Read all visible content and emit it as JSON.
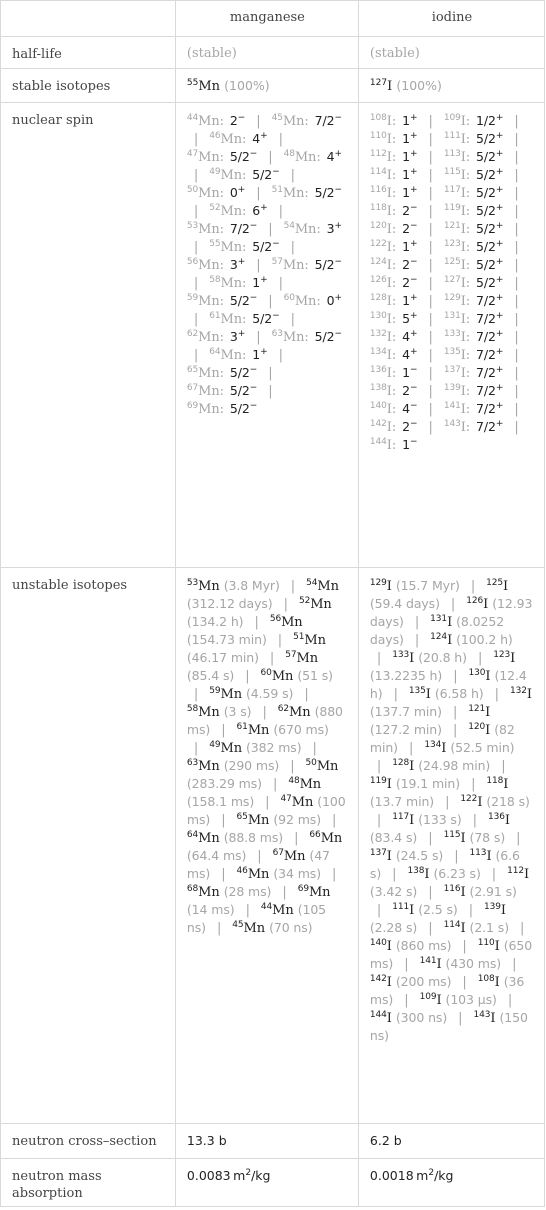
{
  "table": {
    "columns": [
      "",
      "manganese",
      "iodine"
    ],
    "rows": {
      "half_life": {
        "label": "half-life",
        "manganese": "(stable)",
        "iodine": "(stable)"
      },
      "stable_isotopes": {
        "label": "stable isotopes",
        "manganese": {
          "mass": "55",
          "symbol": "Mn",
          "abundance": "(100%)"
        },
        "iodine": {
          "mass": "127",
          "symbol": "I",
          "abundance": "(100%)"
        }
      },
      "nuclear_spin": {
        "label": "nuclear spin",
        "manganese": [
          {
            "mass": "44",
            "symbol": "Mn:",
            "spin": "2",
            "parity": "−"
          },
          {
            "mass": "45",
            "symbol": "Mn:",
            "spin": "7/2",
            "parity": "−"
          },
          {
            "mass": "46",
            "symbol": "Mn:",
            "spin": "4",
            "parity": "+"
          },
          {
            "mass": "47",
            "symbol": "Mn:",
            "spin": "5/2",
            "parity": "−"
          },
          {
            "mass": "48",
            "symbol": "Mn:",
            "spin": "4",
            "parity": "+"
          },
          {
            "mass": "49",
            "symbol": "Mn:",
            "spin": "5/2",
            "parity": "−"
          },
          {
            "mass": "50",
            "symbol": "Mn:",
            "spin": "0",
            "parity": "+"
          },
          {
            "mass": "51",
            "symbol": "Mn:",
            "spin": "5/2",
            "parity": "−"
          },
          {
            "mass": "52",
            "symbol": "Mn:",
            "spin": "6",
            "parity": "+"
          },
          {
            "mass": "53",
            "symbol": "Mn:",
            "spin": "7/2",
            "parity": "−"
          },
          {
            "mass": "54",
            "symbol": "Mn:",
            "spin": "3",
            "parity": "+"
          },
          {
            "mass": "55",
            "symbol": "Mn:",
            "spin": "5/2",
            "parity": "−"
          },
          {
            "mass": "56",
            "symbol": "Mn:",
            "spin": "3",
            "parity": "+"
          },
          {
            "mass": "57",
            "symbol": "Mn:",
            "spin": "5/2",
            "parity": "−"
          },
          {
            "mass": "58",
            "symbol": "Mn:",
            "spin": "1",
            "parity": "+"
          },
          {
            "mass": "59",
            "symbol": "Mn:",
            "spin": "5/2",
            "parity": "−"
          },
          {
            "mass": "60",
            "symbol": "Mn:",
            "spin": "0",
            "parity": "+"
          },
          {
            "mass": "61",
            "symbol": "Mn:",
            "spin": "5/2",
            "parity": "−"
          },
          {
            "mass": "62",
            "symbol": "Mn:",
            "spin": "3",
            "parity": "+"
          },
          {
            "mass": "63",
            "symbol": "Mn:",
            "spin": "5/2",
            "parity": "−"
          },
          {
            "mass": "64",
            "symbol": "Mn:",
            "spin": "1",
            "parity": "+"
          },
          {
            "mass": "65",
            "symbol": "Mn:",
            "spin": "5/2",
            "parity": "−"
          },
          {
            "mass": "67",
            "symbol": "Mn:",
            "spin": "5/2",
            "parity": "−"
          },
          {
            "mass": "69",
            "symbol": "Mn:",
            "spin": "5/2",
            "parity": "−"
          }
        ],
        "iodine": [
          {
            "mass": "108",
            "symbol": "I:",
            "spin": "1",
            "parity": "+"
          },
          {
            "mass": "109",
            "symbol": "I:",
            "spin": "1/2",
            "parity": "+"
          },
          {
            "mass": "110",
            "symbol": "I:",
            "spin": "1",
            "parity": "+"
          },
          {
            "mass": "111",
            "symbol": "I:",
            "spin": "5/2",
            "parity": "+"
          },
          {
            "mass": "112",
            "symbol": "I:",
            "spin": "1",
            "parity": "+"
          },
          {
            "mass": "113",
            "symbol": "I:",
            "spin": "5/2",
            "parity": "+"
          },
          {
            "mass": "114",
            "symbol": "I:",
            "spin": "1",
            "parity": "+"
          },
          {
            "mass": "115",
            "symbol": "I:",
            "spin": "5/2",
            "parity": "+"
          },
          {
            "mass": "116",
            "symbol": "I:",
            "spin": "1",
            "parity": "+"
          },
          {
            "mass": "117",
            "symbol": "I:",
            "spin": "5/2",
            "parity": "+"
          },
          {
            "mass": "118",
            "symbol": "I:",
            "spin": "2",
            "parity": "−"
          },
          {
            "mass": "119",
            "symbol": "I:",
            "spin": "5/2",
            "parity": "+"
          },
          {
            "mass": "120",
            "symbol": "I:",
            "spin": "2",
            "parity": "−"
          },
          {
            "mass": "121",
            "symbol": "I:",
            "spin": "5/2",
            "parity": "+"
          },
          {
            "mass": "122",
            "symbol": "I:",
            "spin": "1",
            "parity": "+"
          },
          {
            "mass": "123",
            "symbol": "I:",
            "spin": "5/2",
            "parity": "+"
          },
          {
            "mass": "124",
            "symbol": "I:",
            "spin": "2",
            "parity": "−"
          },
          {
            "mass": "125",
            "symbol": "I:",
            "spin": "5/2",
            "parity": "+"
          },
          {
            "mass": "126",
            "symbol": "I:",
            "spin": "2",
            "parity": "−"
          },
          {
            "mass": "127",
            "symbol": "I:",
            "spin": "5/2",
            "parity": "+"
          },
          {
            "mass": "128",
            "symbol": "I:",
            "spin": "1",
            "parity": "+"
          },
          {
            "mass": "129",
            "symbol": "I:",
            "spin": "7/2",
            "parity": "+"
          },
          {
            "mass": "130",
            "symbol": "I:",
            "spin": "5",
            "parity": "+"
          },
          {
            "mass": "131",
            "symbol": "I:",
            "spin": "7/2",
            "parity": "+"
          },
          {
            "mass": "132",
            "symbol": "I:",
            "spin": "4",
            "parity": "+"
          },
          {
            "mass": "133",
            "symbol": "I:",
            "spin": "7/2",
            "parity": "+"
          },
          {
            "mass": "134",
            "symbol": "I:",
            "spin": "4",
            "parity": "+"
          },
          {
            "mass": "135",
            "symbol": "I:",
            "spin": "7/2",
            "parity": "+"
          },
          {
            "mass": "136",
            "symbol": "I:",
            "spin": "1",
            "parity": "−"
          },
          {
            "mass": "137",
            "symbol": "I:",
            "spin": "7/2",
            "parity": "+"
          },
          {
            "mass": "138",
            "symbol": "I:",
            "spin": "2",
            "parity": "−"
          },
          {
            "mass": "139",
            "symbol": "I:",
            "spin": "7/2",
            "parity": "+"
          },
          {
            "mass": "140",
            "symbol": "I:",
            "spin": "4",
            "parity": "−"
          },
          {
            "mass": "141",
            "symbol": "I:",
            "spin": "7/2",
            "parity": "+"
          },
          {
            "mass": "142",
            "symbol": "I:",
            "spin": "2",
            "parity": "−"
          },
          {
            "mass": "143",
            "symbol": "I:",
            "spin": "7/2",
            "parity": "+"
          },
          {
            "mass": "144",
            "symbol": "I:",
            "spin": "1",
            "parity": "−"
          }
        ]
      },
      "unstable_isotopes": {
        "label": "unstable isotopes",
        "manganese": [
          {
            "mass": "53",
            "symbol": "Mn",
            "half_life": "(3.8 Myr)"
          },
          {
            "mass": "54",
            "symbol": "Mn",
            "half_life": "(312.12 days)"
          },
          {
            "mass": "52",
            "symbol": "Mn",
            "half_life": "(134.2 h)"
          },
          {
            "mass": "56",
            "symbol": "Mn",
            "half_life": "(154.73 min)"
          },
          {
            "mass": "51",
            "symbol": "Mn",
            "half_life": "(46.17 min)"
          },
          {
            "mass": "57",
            "symbol": "Mn",
            "half_life": "(85.4 s)"
          },
          {
            "mass": "60",
            "symbol": "Mn",
            "half_life": "(51 s)"
          },
          {
            "mass": "59",
            "symbol": "Mn",
            "half_life": "(4.59 s)"
          },
          {
            "mass": "58",
            "symbol": "Mn",
            "half_life": "(3 s)"
          },
          {
            "mass": "62",
            "symbol": "Mn",
            "half_life": "(880 ms)"
          },
          {
            "mass": "61",
            "symbol": "Mn",
            "half_life": "(670 ms)"
          },
          {
            "mass": "49",
            "symbol": "Mn",
            "half_life": "(382 ms)"
          },
          {
            "mass": "63",
            "symbol": "Mn",
            "half_life": "(290 ms)"
          },
          {
            "mass": "50",
            "symbol": "Mn",
            "half_life": "(283.29 ms)"
          },
          {
            "mass": "48",
            "symbol": "Mn",
            "half_life": "(158.1 ms)"
          },
          {
            "mass": "47",
            "symbol": "Mn",
            "half_life": "(100 ms)"
          },
          {
            "mass": "65",
            "symbol": "Mn",
            "half_life": "(92 ms)"
          },
          {
            "mass": "64",
            "symbol": "Mn",
            "half_life": "(88.8 ms)"
          },
          {
            "mass": "66",
            "symbol": "Mn",
            "half_life": "(64.4 ms)"
          },
          {
            "mass": "67",
            "symbol": "Mn",
            "half_life": "(47 ms)"
          },
          {
            "mass": "46",
            "symbol": "Mn",
            "half_life": "(34 ms)"
          },
          {
            "mass": "68",
            "symbol": "Mn",
            "half_life": "(28 ms)"
          },
          {
            "mass": "69",
            "symbol": "Mn",
            "half_life": "(14 ms)"
          },
          {
            "mass": "44",
            "symbol": "Mn",
            "half_life": "(105 ns)"
          },
          {
            "mass": "45",
            "symbol": "Mn",
            "half_life": "(70 ns)"
          }
        ],
        "iodine": [
          {
            "mass": "129",
            "symbol": "I",
            "half_life": "(15.7 Myr)"
          },
          {
            "mass": "125",
            "symbol": "I",
            "half_life": "(59.4 days)"
          },
          {
            "mass": "126",
            "symbol": "I",
            "half_life": "(12.93 days)"
          },
          {
            "mass": "131",
            "symbol": "I",
            "half_life": "(8.0252 days)"
          },
          {
            "mass": "124",
            "symbol": "I",
            "half_life": "(100.2 h)"
          },
          {
            "mass": "133",
            "symbol": "I",
            "half_life": "(20.8 h)"
          },
          {
            "mass": "123",
            "symbol": "I",
            "half_life": "(13.2235 h)"
          },
          {
            "mass": "130",
            "symbol": "I",
            "half_life": "(12.4 h)"
          },
          {
            "mass": "135",
            "symbol": "I",
            "half_life": "(6.58 h)"
          },
          {
            "mass": "132",
            "symbol": "I",
            "half_life": "(137.7 min)"
          },
          {
            "mass": "121",
            "symbol": "I",
            "half_life": "(127.2 min)"
          },
          {
            "mass": "120",
            "symbol": "I",
            "half_life": "(82 min)"
          },
          {
            "mass": "134",
            "symbol": "I",
            "half_life": "(52.5 min)"
          },
          {
            "mass": "128",
            "symbol": "I",
            "half_life": "(24.98 min)"
          },
          {
            "mass": "119",
            "symbol": "I",
            "half_life": "(19.1 min)"
          },
          {
            "mass": "118",
            "symbol": "I",
            "half_life": "(13.7 min)"
          },
          {
            "mass": "122",
            "symbol": "I",
            "half_life": "(218 s)"
          },
          {
            "mass": "117",
            "symbol": "I",
            "half_life": "(133 s)"
          },
          {
            "mass": "136",
            "symbol": "I",
            "half_life": "(83.4 s)"
          },
          {
            "mass": "115",
            "symbol": "I",
            "half_life": "(78 s)"
          },
          {
            "mass": "137",
            "symbol": "I",
            "half_life": "(24.5 s)"
          },
          {
            "mass": "113",
            "symbol": "I",
            "half_life": "(6.6 s)"
          },
          {
            "mass": "138",
            "symbol": "I",
            "half_life": "(6.23 s)"
          },
          {
            "mass": "112",
            "symbol": "I",
            "half_life": "(3.42 s)"
          },
          {
            "mass": "116",
            "symbol": "I",
            "half_life": "(2.91 s)"
          },
          {
            "mass": "111",
            "symbol": "I",
            "half_life": "(2.5 s)"
          },
          {
            "mass": "139",
            "symbol": "I",
            "half_life": "(2.28 s)"
          },
          {
            "mass": "114",
            "symbol": "I",
            "half_life": "(2.1 s)"
          },
          {
            "mass": "140",
            "symbol": "I",
            "half_life": "(860 ms)"
          },
          {
            "mass": "110",
            "symbol": "I",
            "half_life": "(650 ms)"
          },
          {
            "mass": "141",
            "symbol": "I",
            "half_life": "(430 ms)"
          },
          {
            "mass": "142",
            "symbol": "I",
            "half_life": "(200 ms)"
          },
          {
            "mass": "108",
            "symbol": "I",
            "half_life": "(36 ms)"
          },
          {
            "mass": "109",
            "symbol": "I",
            "half_life": "(103 μs)"
          },
          {
            "mass": "144",
            "symbol": "I",
            "half_life": "(300 ns)"
          },
          {
            "mass": "143",
            "symbol": "I",
            "half_life": "(150 ns)"
          }
        ]
      },
      "neutron_cross_section": {
        "label": "neutron cross–section",
        "manganese": "13.3 b",
        "iodine": "6.2 b"
      },
      "neutron_mass_absorption": {
        "label": "neutron mass absorption",
        "manganese": {
          "value": "0.0083",
          "unit": "m",
          "exp": "2",
          "rest": "/kg"
        },
        "iodine": {
          "value": "0.0018",
          "unit": "m",
          "exp": "2",
          "rest": "/kg"
        }
      }
    },
    "separator": "|"
  }
}
